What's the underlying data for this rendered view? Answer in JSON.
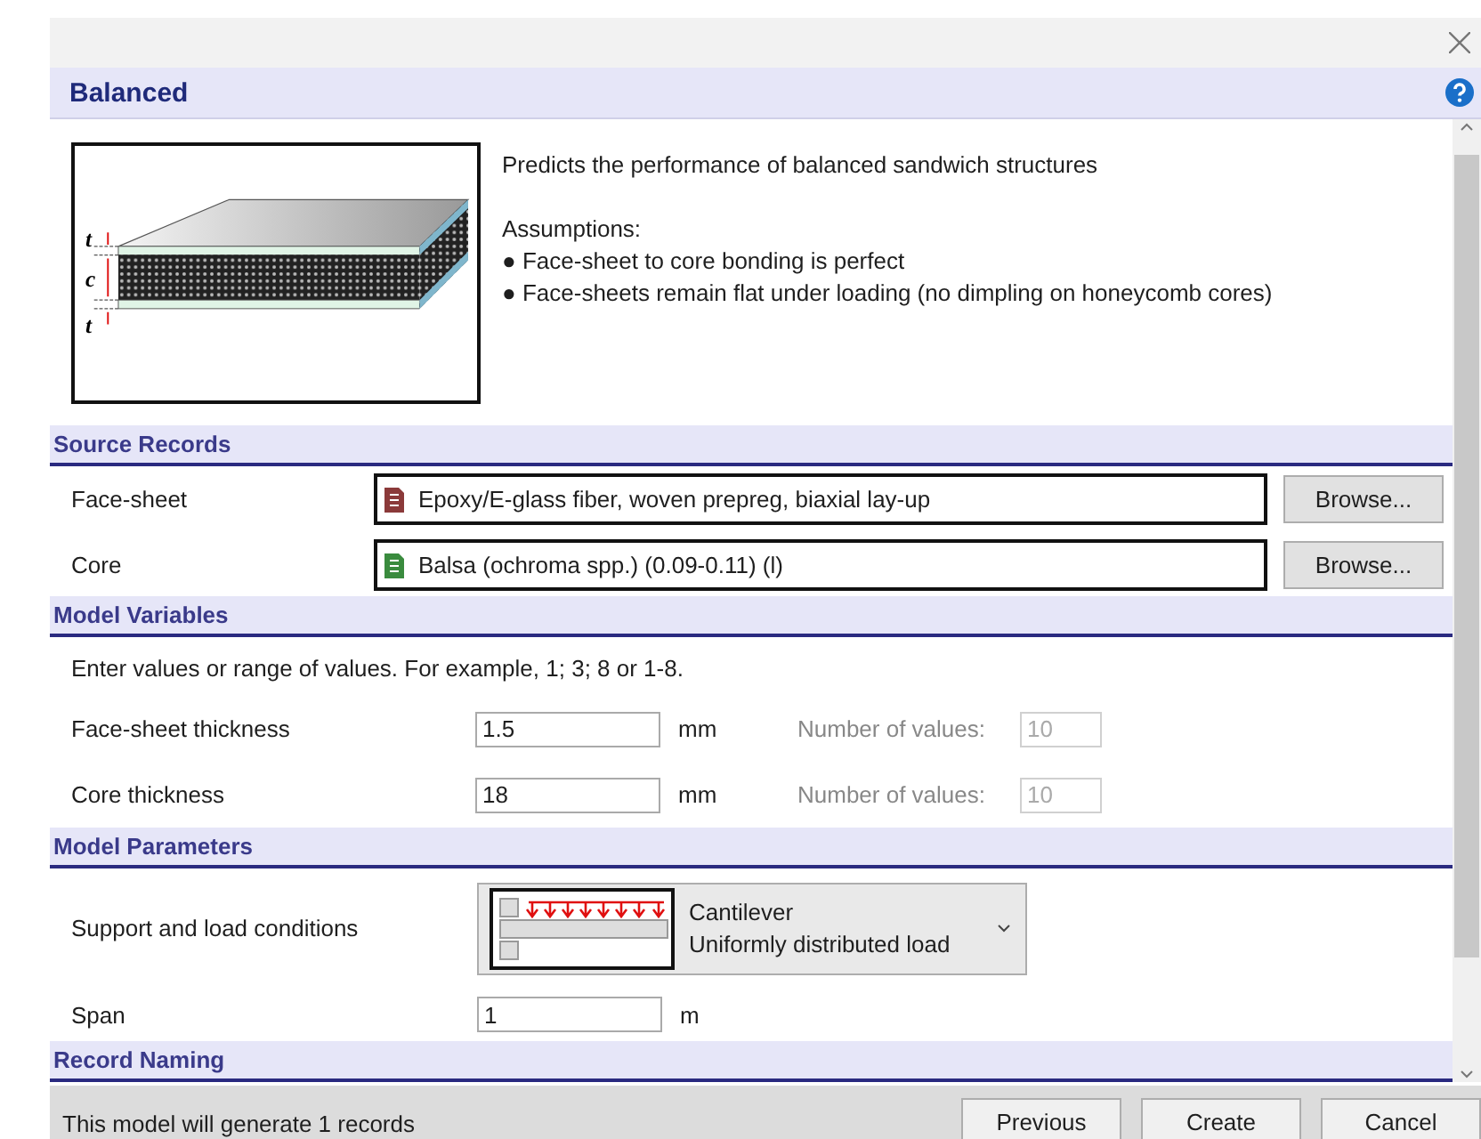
{
  "dialog": {
    "title": "Balanced",
    "description": "Predicts the performance of balanced sandwich structures",
    "assumptions_title": "Assumptions:",
    "assumptions": [
      "● Face-sheet to core bonding is perfect",
      "● Face-sheets remain flat under loading (no dimpling on honeycomb cores)"
    ],
    "diagram_labels": [
      "t",
      "c",
      "t"
    ]
  },
  "sections": [
    {
      "kind": "records",
      "title": "Source Records",
      "rows": [
        {
          "label": "Face-sheet",
          "value": "Epoxy/E-glass fiber, woven prepreg, biaxial lay-up",
          "color": "#8b3a3a",
          "button": "Browse..."
        },
        {
          "label": "Core",
          "value": "Balsa (ochroma spp.) (0.09-0.11) (l)",
          "color": "#3a8b3e",
          "button": "Browse..."
        }
      ]
    },
    {
      "kind": "variables",
      "title": "Model Variables",
      "hint": "Enter values or range of values. For example, 1; 3; 8 or 1-8.",
      "rows": [
        {
          "label": "Face-sheet thickness",
          "value": "1.5",
          "unit": "mm",
          "count_label": "Number of values:",
          "count": "10",
          "disabled": true
        },
        {
          "label": "Core thickness",
          "value": "18",
          "unit": "mm",
          "count_label": "Number of values:",
          "count": "10",
          "disabled": true
        }
      ]
    },
    {
      "kind": "parameters",
      "title": "Model Parameters",
      "support": {
        "label": "Support and load conditions",
        "line1": "Cantilever",
        "line2": "Uniformly distributed load"
      },
      "rows": [
        {
          "label": "Span",
          "value": "1",
          "unit": "m"
        }
      ]
    },
    {
      "kind": "naming",
      "title": "Record Naming"
    }
  ],
  "footer": {
    "message": "This model will generate 1 records",
    "buttons": [
      "Previous",
      "Create",
      "Cancel"
    ]
  }
}
